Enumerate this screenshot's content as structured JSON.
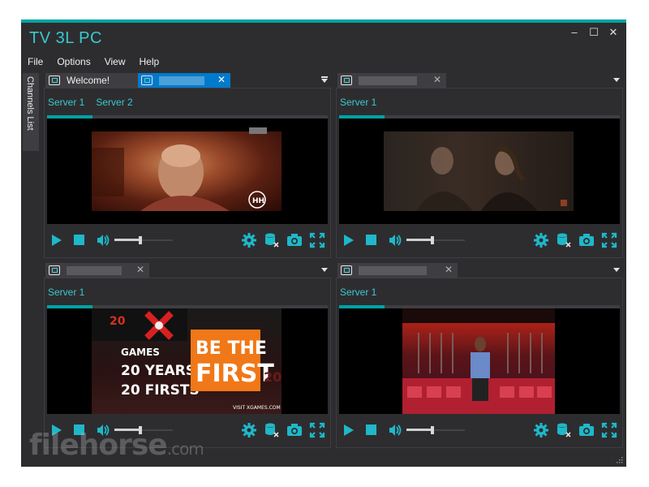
{
  "app": {
    "title": "TV 3L PC"
  },
  "window_controls": {
    "minimize": "–",
    "maximize": "☐",
    "close": "✕"
  },
  "menu": [
    "File",
    "Options",
    "View",
    "Help"
  ],
  "sidebar": {
    "channels_tab": "Channels List"
  },
  "panels": [
    {
      "tabs": [
        {
          "label": "Welcome!",
          "active": false
        },
        {
          "label": "",
          "active": true,
          "close": "✕"
        }
      ],
      "servers": [
        "Server 1",
        "Server 2"
      ]
    },
    {
      "tabs": [
        {
          "label": "",
          "active": false,
          "close": "✕"
        }
      ],
      "servers": [
        "Server 1"
      ]
    },
    {
      "tabs": [
        {
          "label": "",
          "active": false,
          "close": "✕"
        }
      ],
      "servers": [
        "Server 1"
      ]
    },
    {
      "tabs": [
        {
          "label": "",
          "active": false,
          "close": "✕"
        }
      ],
      "servers": [
        "Server 1"
      ]
    }
  ],
  "video_overlays": {
    "xgames": [
      "20",
      "GAMES",
      "20 YEARS,",
      "20 FIRSTS",
      "BE THE",
      "FIRST",
      "VISIT XGAMES.COM"
    ],
    "logo_badge": "HH"
  },
  "watermark": {
    "main": "filehorse",
    "suffix": ".com"
  },
  "colors": {
    "accent": "#00a3a3",
    "accent_text": "#3ac9d0",
    "icon": "#1fb8c9",
    "active_tab": "#007acc",
    "bg": "#2d2d30"
  },
  "player": {
    "volume_level": 0.45
  }
}
